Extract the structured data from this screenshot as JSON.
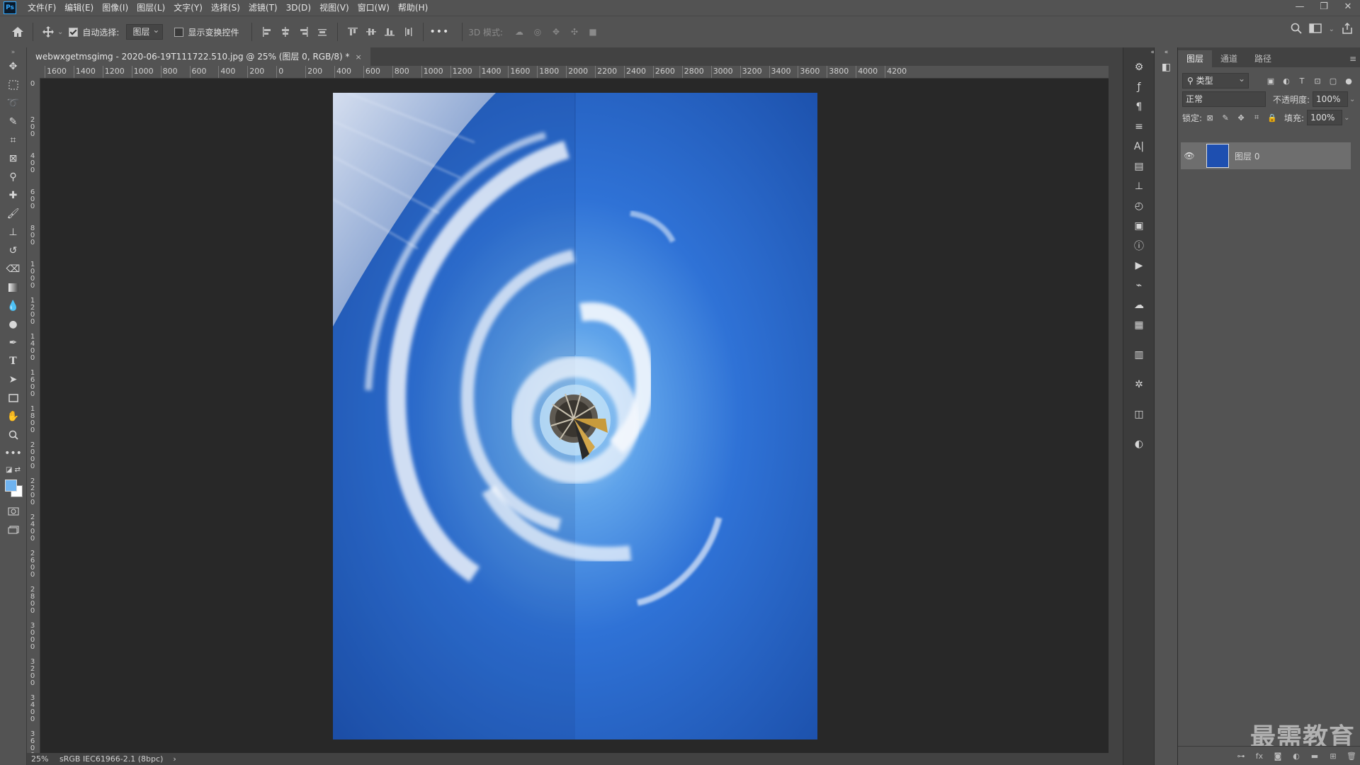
{
  "app": {
    "logo": "Ps"
  },
  "menu": [
    "文件(F)",
    "编辑(E)",
    "图像(I)",
    "图层(L)",
    "文字(Y)",
    "选择(S)",
    "滤镜(T)",
    "3D(D)",
    "视图(V)",
    "窗口(W)",
    "帮助(H)"
  ],
  "window_controls": {
    "minimize": "—",
    "restore": "❐",
    "close": "✕"
  },
  "options": {
    "auto_select_label": "自动选择:",
    "auto_select_checked": true,
    "auto_select_target": "图层",
    "show_transform_label": "显示变换控件",
    "show_transform_checked": false,
    "more": "•••",
    "mode_3d_label": "3D 模式:"
  },
  "document": {
    "tab_title": "webwxgetmsgimg - 2020-06-19T111722.510.jpg @ 25% (图层 0, RGB/8) *",
    "close": "×"
  },
  "ruler_h_labels": [
    "1600",
    "1400",
    "1200",
    "1000",
    "800",
    "600",
    "400",
    "200",
    "0",
    "200",
    "400",
    "600",
    "800",
    "1000",
    "1200",
    "1400",
    "1600",
    "1800",
    "2000",
    "2200",
    "2400",
    "2600",
    "2800",
    "3000",
    "3200",
    "3400",
    "3600",
    "3800",
    "4000",
    "4200"
  ],
  "ruler_v_labels": [
    "0",
    "2 0 0",
    "4 0 0",
    "6 0 0",
    "8 0 0",
    "1 0 0 0",
    "1 2 0 0",
    "1 4 0 0",
    "1 6 0 0",
    "1 8 0 0",
    "2 0 0 0",
    "2 2 0 0",
    "2 4 0 0",
    "2 6 0 0",
    "2 8 0 0",
    "3 0 0 0",
    "3 2 0 0",
    "3 4 0 0",
    "3 6 0 0"
  ],
  "status": {
    "zoom": "25%",
    "profile": "sRGB IEC61966-2.1 (8bpc)",
    "arrow": "›"
  },
  "layers_panel": {
    "tabs": [
      "图层",
      "通道",
      "路径"
    ],
    "active_tab": 0,
    "filter_kind": "类型",
    "blend_mode": "正常",
    "opacity_label": "不透明度:",
    "opacity_value": "100%",
    "lock_label": "锁定:",
    "fill_label": "填充:",
    "fill_value": "100%",
    "layers": [
      {
        "name": "图层 0",
        "visible": true
      }
    ]
  },
  "watermark": "最需教育",
  "colors": {
    "foreground": "#6fb3f0",
    "background": "#ffffff",
    "sky": "#2156b5"
  }
}
